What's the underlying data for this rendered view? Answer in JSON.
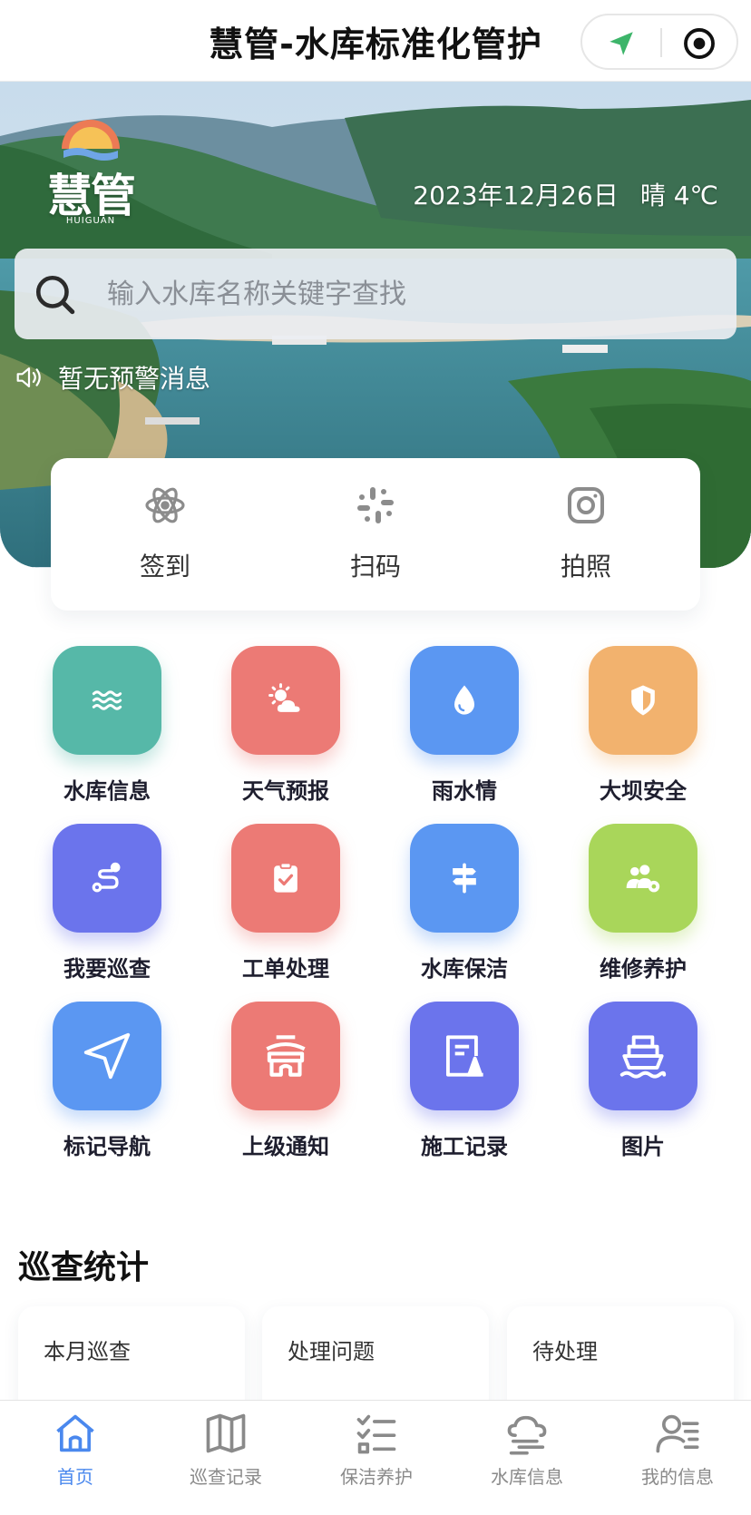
{
  "nav": {
    "title": "慧管-水库标准化管护"
  },
  "hero": {
    "logo_text": "慧管",
    "logo_sub": "HUIGUAN",
    "date": "2023年12月26日",
    "weather": "晴 4℃",
    "search_placeholder": "输入水库名称关键字查找",
    "alert_text": "暂无预警消息"
  },
  "quick_actions": [
    {
      "label": "签到",
      "icon": "atom-icon"
    },
    {
      "label": "扫码",
      "icon": "scan-icon"
    },
    {
      "label": "拍照",
      "icon": "camera-icon"
    }
  ],
  "grid": [
    {
      "label": "水库信息",
      "icon": "waves-icon",
      "color": "#56b8a8"
    },
    {
      "label": "天气预报",
      "icon": "sun-cloud-icon",
      "color": "#ec7a75"
    },
    {
      "label": "雨水情",
      "icon": "water-drop-icon",
      "color": "#5b97f2"
    },
    {
      "label": "大坝安全",
      "icon": "shield-icon",
      "color": "#f2b26e"
    },
    {
      "label": "我要巡查",
      "icon": "route-icon",
      "color": "#6b74ec"
    },
    {
      "label": "工单处理",
      "icon": "clipboard-check-icon",
      "color": "#ec7a75"
    },
    {
      "label": "水库保洁",
      "icon": "signpost-icon",
      "color": "#5b97f2"
    },
    {
      "label": "维修养护",
      "icon": "team-settings-icon",
      "color": "#a9d65a"
    },
    {
      "label": "标记导航",
      "icon": "navigation-icon",
      "color": "#5b97f2"
    },
    {
      "label": "上级通知",
      "icon": "building-icon",
      "color": "#ec7a75"
    },
    {
      "label": "施工记录",
      "icon": "document-cone-icon",
      "color": "#6b74ec"
    },
    {
      "label": "图片",
      "icon": "ship-icon",
      "color": "#6b74ec"
    }
  ],
  "stats": {
    "title": "巡查统计",
    "cards": [
      {
        "label": "本月巡查",
        "value": "",
        "color": "#4a7be8"
      },
      {
        "label": "处理问题",
        "value": "",
        "color": "#3fb79b"
      },
      {
        "label": "待处理",
        "value": "",
        "color": "#e9564a"
      }
    ]
  },
  "tabs": [
    {
      "label": "首页",
      "icon": "home-icon",
      "active": true
    },
    {
      "label": "巡查记录",
      "icon": "map-icon",
      "active": false
    },
    {
      "label": "保洁养护",
      "icon": "checklist-icon",
      "active": false
    },
    {
      "label": "水库信息",
      "icon": "cloud-wind-icon",
      "active": false
    },
    {
      "label": "我的信息",
      "icon": "user-list-icon",
      "active": false
    }
  ],
  "colors": {
    "accent": "#4a88ee",
    "location_green": "#3db56a"
  }
}
